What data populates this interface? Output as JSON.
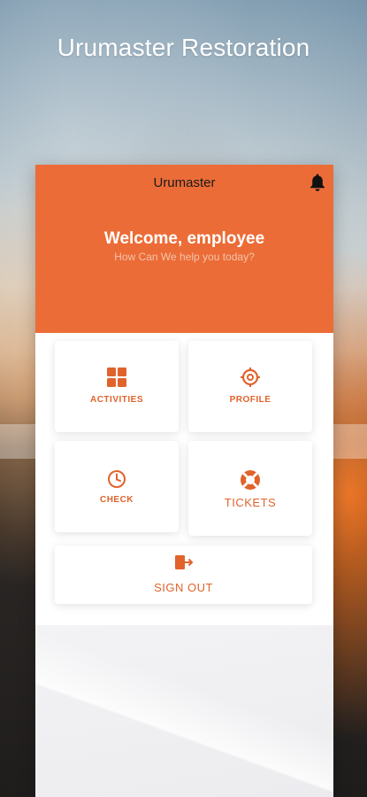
{
  "promo": {
    "title": "Urumaster Restoration"
  },
  "app": {
    "title": "Urumaster",
    "icons": {
      "notifications": "bell-icon"
    }
  },
  "welcome": {
    "title": "Welcome, employee",
    "subtitle": "How Can We help you today?"
  },
  "menu": {
    "activities": {
      "label": "ACTIVITIES",
      "icon": "grid-icon"
    },
    "profile": {
      "label": "PROFILE",
      "icon": "gear-icon"
    },
    "check": {
      "label": "CHECK",
      "icon": "clock-icon"
    },
    "tickets": {
      "label": "TICKETS",
      "icon": "lifebuoy-icon"
    },
    "signout": {
      "label": "SIGN OUT",
      "icon": "sign-out-icon"
    }
  },
  "colors": {
    "accent": "#ec6c37",
    "accent_text": "#e0632c"
  }
}
